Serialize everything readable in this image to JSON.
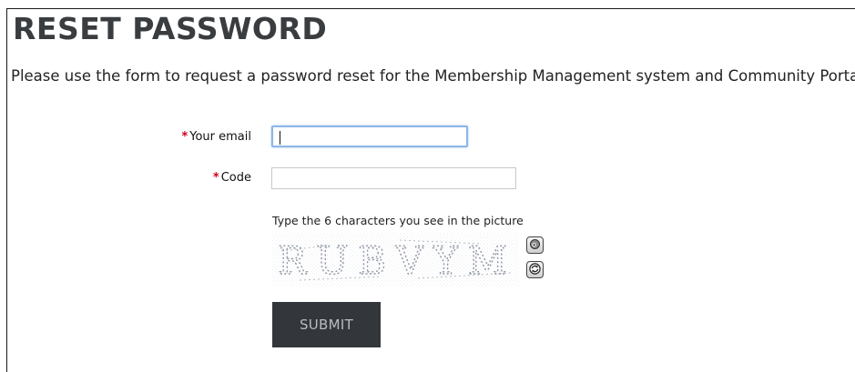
{
  "page": {
    "title": "RESET PASSWORD",
    "intro": "Please use the form to request a password reset for the Membership Management system and Community Portal"
  },
  "form": {
    "required_marker": "*",
    "email": {
      "label": "Your email",
      "value": "",
      "placeholder": ""
    },
    "code": {
      "label": "Code",
      "value": "",
      "placeholder": ""
    },
    "captcha": {
      "hint": "Type the 6 characters you see in the picture",
      "text": "RUBVYM",
      "audio_icon": "audio-icon",
      "refresh_icon": "refresh-icon"
    },
    "submit_label": "SUBMIT"
  },
  "colors": {
    "required": "#d0021b",
    "submit_bg": "#33373b",
    "submit_text": "#b9bcc0",
    "focus_border": "#8fb6e6",
    "title": "#3a3d40"
  }
}
